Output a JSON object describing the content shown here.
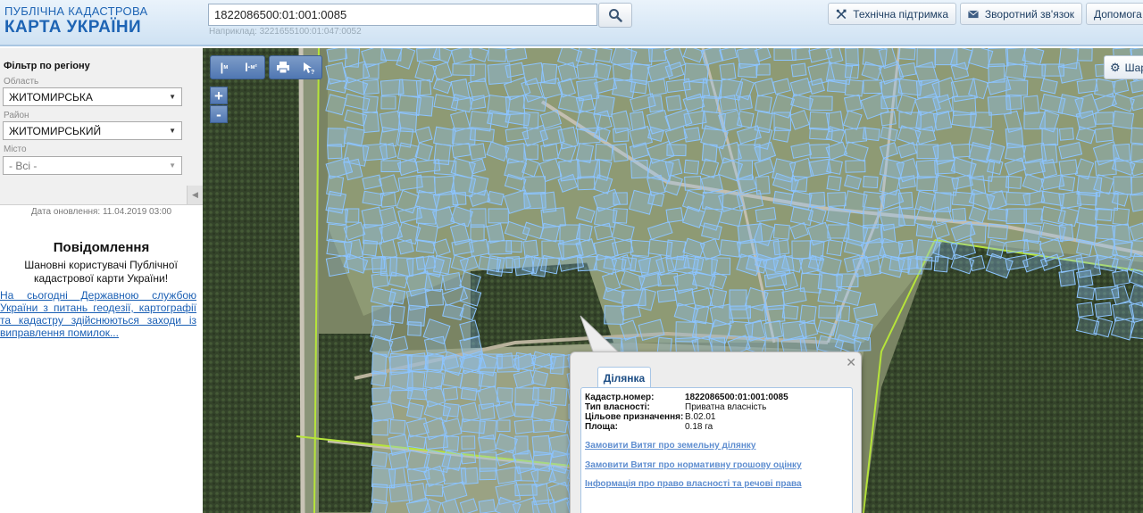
{
  "header": {
    "logo_line1": "ПУБЛІЧНА КАДАСТРОВА",
    "logo_line2": "КАРТА УКРАЇНИ",
    "search_value": "1822086500:01:001:0085",
    "search_example": "Наприклад: 3221655100:01:047:0052",
    "buttons": {
      "support": "Технічна підтримка",
      "feedback": "Зворотний зв'язок",
      "help": "Допомога"
    }
  },
  "sidebar": {
    "filter_title": "Фільтр по регіону",
    "region_label": "Область",
    "region_value": "ЖИТОМИРСЬКА",
    "district_label": "Район",
    "district_value": "ЖИТОМИРСЬКИЙ",
    "city_label": "Місто",
    "city_value": "- Всі -",
    "update_date": "Дата оновлення: 11.04.2019 03:00",
    "message_title": "Повідомлення",
    "message_body": "Шановні користувачі Публічної кадастрової карти України!",
    "message_link": "На сьогодні Державною службою України з питань геодезії, картографії та кадастру здійснюються заходи із виправлення помилок..."
  },
  "map": {
    "layers_label": "Шари"
  },
  "popup": {
    "tab_label": "Ділянка",
    "fields": [
      {
        "key": "Кадастр.номер:",
        "value": "1822086500:01:001:0085",
        "bold": true
      },
      {
        "key": "Тип власності:",
        "value": "Приватна власність",
        "bold": false
      },
      {
        "key": "Цільове призначення:",
        "value": "В.02.01",
        "bold": false
      },
      {
        "key": "Площа:",
        "value": "0.18 га",
        "bold": false
      }
    ],
    "links": [
      "Замовити Витяг про земельну ділянку",
      "Замовити Витяг про нормативну грошову оцінку",
      "Інформація про право власності та речові права"
    ]
  },
  "colors": {
    "brand_blue": "#1e64b4",
    "parcel_outline": "#8cc4ff",
    "boundary_green": "#b6e43a",
    "link_blue": "#5f8ed0"
  }
}
